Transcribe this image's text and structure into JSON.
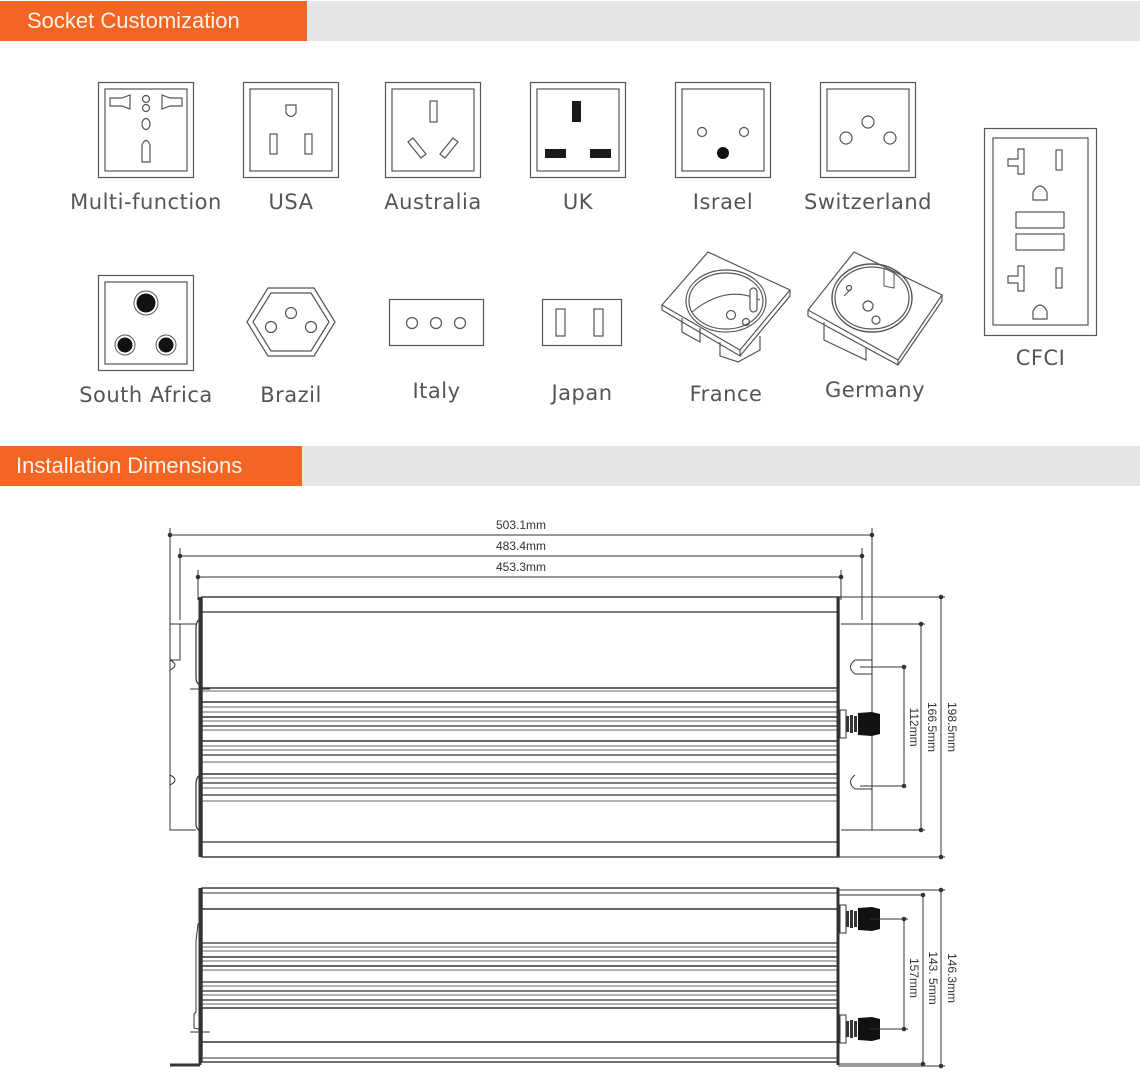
{
  "sections": {
    "socket_customization": "Socket Customization",
    "installation_dimensions": "Installation Dimensions"
  },
  "theme": {
    "accent": "#f26522",
    "bar_bg": "#e4e5e7"
  },
  "sockets": [
    {
      "id": "multi-function",
      "label": "Multi-function",
      "icon": "multi-function-socket-icon"
    },
    {
      "id": "usa",
      "label": "USA",
      "icon": "usa-socket-icon"
    },
    {
      "id": "australia",
      "label": "Australia",
      "icon": "australia-socket-icon"
    },
    {
      "id": "uk",
      "label": "UK",
      "icon": "uk-socket-icon"
    },
    {
      "id": "israel",
      "label": "Israel",
      "icon": "israel-socket-icon"
    },
    {
      "id": "switzerland",
      "label": "Switzerland",
      "icon": "switzerland-socket-icon"
    },
    {
      "id": "cfci",
      "label": "CFCI",
      "icon": "cfci-socket-icon"
    },
    {
      "id": "south-africa",
      "label": "South Africa",
      "icon": "south-africa-socket-icon"
    },
    {
      "id": "brazil",
      "label": "Brazil",
      "icon": "brazil-socket-icon"
    },
    {
      "id": "italy",
      "label": "Italy",
      "icon": "italy-socket-icon"
    },
    {
      "id": "japan",
      "label": "Japan",
      "icon": "japan-socket-icon"
    },
    {
      "id": "france",
      "label": "France",
      "icon": "france-socket-icon"
    },
    {
      "id": "germany",
      "label": "Germany",
      "icon": "germany-socket-icon"
    }
  ],
  "dimensions": {
    "top_view": {
      "overall_width": "503.1mm",
      "mount_width": "483.4mm",
      "body_width": "453.3mm",
      "overall_height": "198.5mm",
      "mount_height": "166.5mm",
      "slot_spacing": "112mm"
    },
    "side_view": {
      "overall_height": "146.3mm",
      "body_height": "143. 5mm",
      "terminal_spacing": "157mm"
    }
  }
}
